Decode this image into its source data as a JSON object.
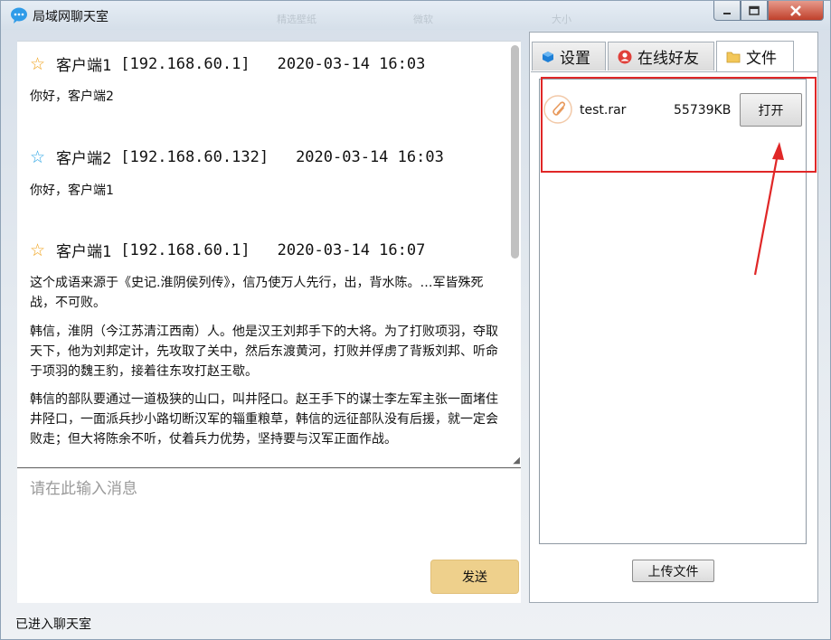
{
  "window": {
    "title": "局域网聊天室",
    "ghost_tabs": [
      "精选壁纸",
      "微软",
      "大小"
    ]
  },
  "chat": {
    "messages": [
      {
        "star_color": "#f0a21b",
        "sender": "客户端1",
        "ip": "[192.168.60.1]",
        "time": "2020-03-14 16:03",
        "paragraphs": [
          "你好，客户端2"
        ]
      },
      {
        "star_color": "#2ea6e6",
        "sender": "客户端2",
        "ip": "[192.168.60.132]",
        "time": "2020-03-14 16:03",
        "paragraphs": [
          "你好，客户端1"
        ]
      },
      {
        "star_color": "#f0a21b",
        "sender": "客户端1",
        "ip": "[192.168.60.1]",
        "time": "2020-03-14 16:07",
        "paragraphs": [
          "这个成语来源于《史记.淮阴侯列传》，信乃使万人先行，出，背水陈。…军皆殊死战，不可败。",
          "韩信，淮阴（今江苏清江西南）人。他是汉王刘邦手下的大将。为了打败项羽，夺取天下，他为刘邦定计，先攻取了关中，然后东渡黄河，打败并俘虏了背叛刘邦、听命于项羽的魏王豹，接着往东攻打赵王歇。",
          "韩信的部队要通过一道极狭的山口，叫井陉口。赵王手下的谋士李左军主张一面堵住井陉口，一面派兵抄小路切断汉军的辎重粮草，韩信的远征部队没有后援，就一定会败走；但大将陈余不听，仗着兵力优势，坚持要与汉军正面作战。"
        ]
      }
    ],
    "input_placeholder": "请在此输入消息",
    "send_label": "发送"
  },
  "status": {
    "text": "已进入聊天室"
  },
  "right_panel": {
    "tabs": [
      {
        "label": "设置",
        "icon": "settings-cube-icon"
      },
      {
        "label": "在线好友",
        "icon": "friends-icon"
      },
      {
        "label": "文件",
        "icon": "folder-icon"
      }
    ],
    "active_tab": "文件",
    "files": [
      {
        "name": "test.rar",
        "size": "55739KB",
        "action_label": "打开",
        "icon": "paperclip-icon"
      }
    ],
    "upload_label": "上传文件"
  },
  "colors": {
    "send_button": "#eed08c",
    "highlight": "#e02727"
  }
}
